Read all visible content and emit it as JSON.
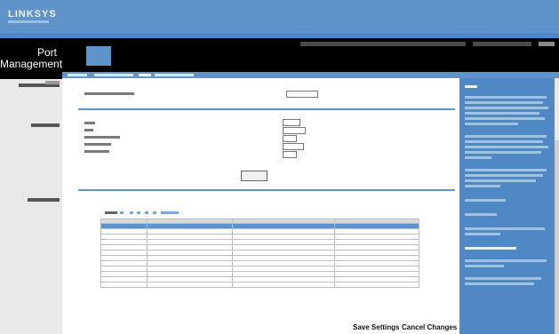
{
  "header": {
    "logo": "LINKSYS",
    "page_title_line1": "Port",
    "page_title_line2": "Management"
  },
  "footer": {
    "save_label": "Save Settings",
    "cancel_label": "Cancel Changes"
  },
  "colors": {
    "primary_blue": "#5f93c9",
    "dark_blue": "#4f88c4",
    "black": "#000000",
    "sidebar_grey": "#e9e9e9"
  },
  "icons": [
    "linksys-logo"
  ]
}
